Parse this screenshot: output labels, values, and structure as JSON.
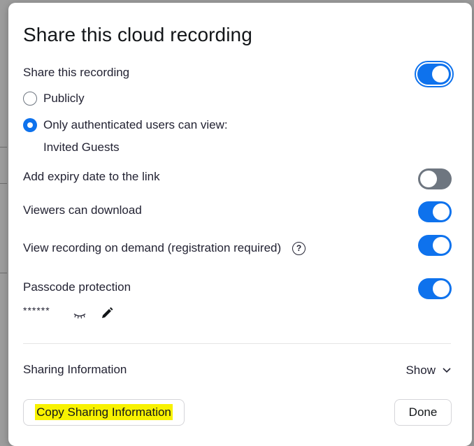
{
  "dialog": {
    "title": "Share this cloud recording",
    "share_recording": {
      "label": "Share this recording",
      "enabled": true
    },
    "visibility": {
      "options": [
        {
          "label": "Publicly",
          "selected": false
        },
        {
          "label": "Only authenticated users can view:",
          "selected": true
        }
      ],
      "sub_label": "Invited Guests"
    },
    "expiry": {
      "label": "Add expiry date to the link",
      "enabled": false
    },
    "download": {
      "label": "Viewers can download",
      "enabled": true
    },
    "on_demand": {
      "label": "View recording on demand (registration required)",
      "help_glyph": "?",
      "enabled": true
    },
    "passcode": {
      "label": "Passcode protection",
      "enabled": true,
      "masked_value": "******",
      "reveal_icon": "eye-closed-icon",
      "edit_icon": "pencil-icon"
    },
    "sharing_info": {
      "label": "Sharing Information",
      "toggle_label": "Show",
      "toggle_icon": "chevron-down-icon"
    },
    "buttons": {
      "copy_label": "Copy Sharing Information",
      "done_label": "Done"
    },
    "colors": {
      "accent": "#0e72ed",
      "toggle_off": "#6e7680",
      "highlight": "#f8f200"
    }
  }
}
